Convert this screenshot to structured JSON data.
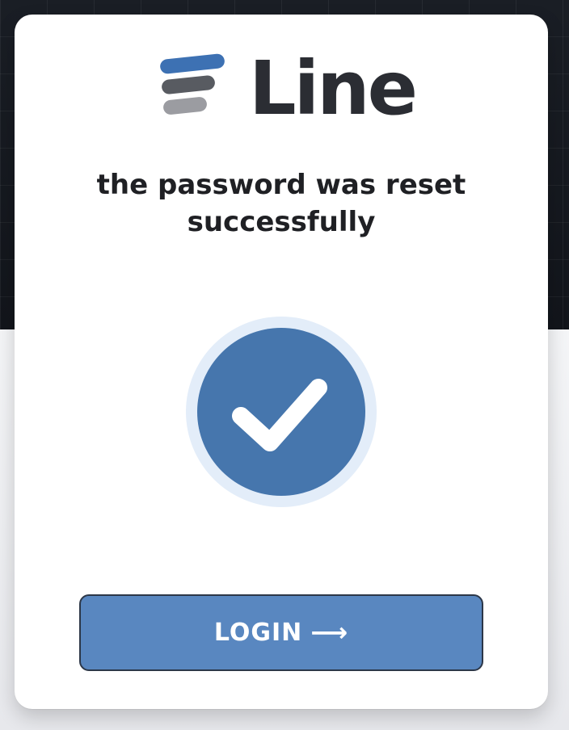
{
  "brand": {
    "name": "Line",
    "icon": "logo-bars-icon",
    "colors": {
      "bar_top": "#3d71b3",
      "bar_middle": "#585b61",
      "bar_bottom": "#9b9ca1",
      "text": "#2b2d33"
    }
  },
  "message": {
    "text": "the password was reset successfully"
  },
  "status_icon": {
    "icon": "check-circle-icon",
    "circle_color": "#4676ad",
    "ring_color": "#e3edf9",
    "check_color": "#ffffff"
  },
  "login_button": {
    "label": "LOGIN",
    "icon": "arrow-right-icon",
    "arrow_glyph": "⟶",
    "color": "#5987c0"
  },
  "colors": {
    "background_dark": "#171a20",
    "background_light": "#eceef1",
    "card": "#ffffff"
  }
}
